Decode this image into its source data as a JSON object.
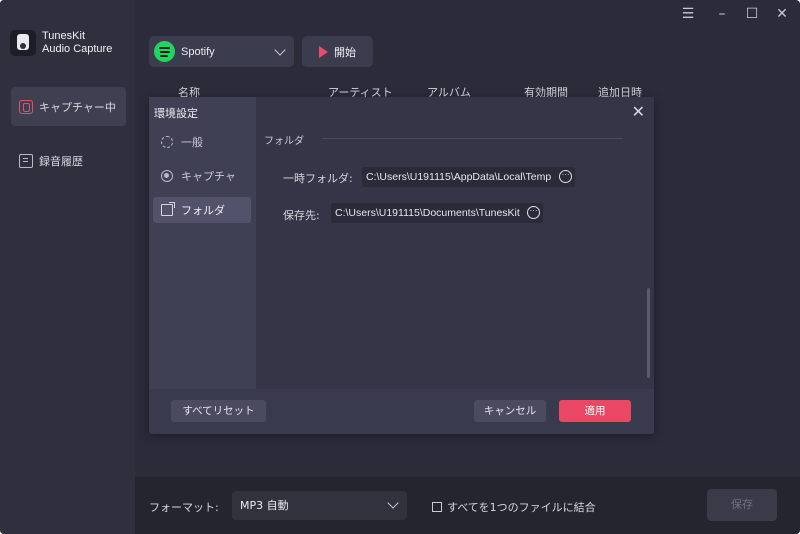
{
  "app": {
    "brand_line1": "TunesKit",
    "brand_line2": "Audio Capture",
    "accent_color": "#ea4764"
  },
  "window_controls": [
    "menu-icon",
    "minimize-icon",
    "maximize-icon",
    "close-icon"
  ],
  "sidebar": {
    "items": [
      {
        "label": "キャプチャー中",
        "icon": "capture-icon",
        "active": true
      },
      {
        "label": "録音履歴",
        "icon": "history-icon",
        "active": false
      }
    ]
  },
  "toolbar": {
    "source_value": "Spotify",
    "source_icon": "spotify-icon",
    "start_label": "開始"
  },
  "table": {
    "columns": [
      "名称",
      "アーティスト",
      "アルバム",
      "有効期間",
      "追加日時"
    ]
  },
  "bottombar": {
    "format_label": "フォーマット:",
    "format_value": "MP3 自動",
    "merge_label": "すべてを1つのファイルに結合",
    "merge_checked": false,
    "save_label": "保存"
  },
  "dialog": {
    "title": "環境設定",
    "tabs": [
      {
        "label": "一般",
        "icon": "gear-icon",
        "active": false
      },
      {
        "label": "キャプチャ",
        "icon": "target-icon",
        "active": false
      },
      {
        "label": "フォルダ",
        "icon": "folder-icon",
        "active": true
      }
    ],
    "section_title": "フォルダ",
    "temp_folder_label": "一時フォルダ:",
    "temp_folder_value": "C:\\Users\\U191115\\AppData\\Local\\Temp",
    "output_label": "保存先:",
    "output_value": "C:\\Users\\U191115\\Documents\\TunesKit",
    "reset_label": "すべてリセット",
    "cancel_label": "キャンセル",
    "apply_label": "適用"
  }
}
